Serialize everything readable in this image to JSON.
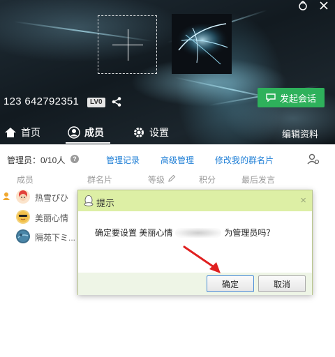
{
  "header": {
    "group_id": "123 642792351",
    "level_badge": "LV0",
    "start_chat_label": "发起会话",
    "nav": {
      "home": "首页",
      "members": "成员",
      "settings": "设置",
      "active": "members"
    },
    "edit_info_label": "编辑资料"
  },
  "admin_bar": {
    "count_text": "管理员：0/10人",
    "help_icon": "?",
    "links": [
      "管理记录",
      "高级管理",
      "修改我的群名片"
    ]
  },
  "table": {
    "columns": [
      "成员",
      "群名片",
      "等级",
      "积分",
      "最后发言"
    ],
    "rows": [
      {
        "name": "热雪ぴひ",
        "owner": true
      },
      {
        "name": "美丽心情",
        "owner": false
      },
      {
        "name": "隔苑下ミ...",
        "owner": false
      }
    ]
  },
  "dialog": {
    "title": "提示",
    "message_before": "确定要设置 美丽心情",
    "message_after": "为管理员吗？",
    "ok_label": "确定",
    "cancel_label": "取消",
    "close_symbol": "×"
  },
  "colors": {
    "accent_green": "#2eb15b",
    "link_blue": "#1f7fd6",
    "dialog_title_bg": "#ddefa5",
    "arrow_red": "#e02020"
  }
}
